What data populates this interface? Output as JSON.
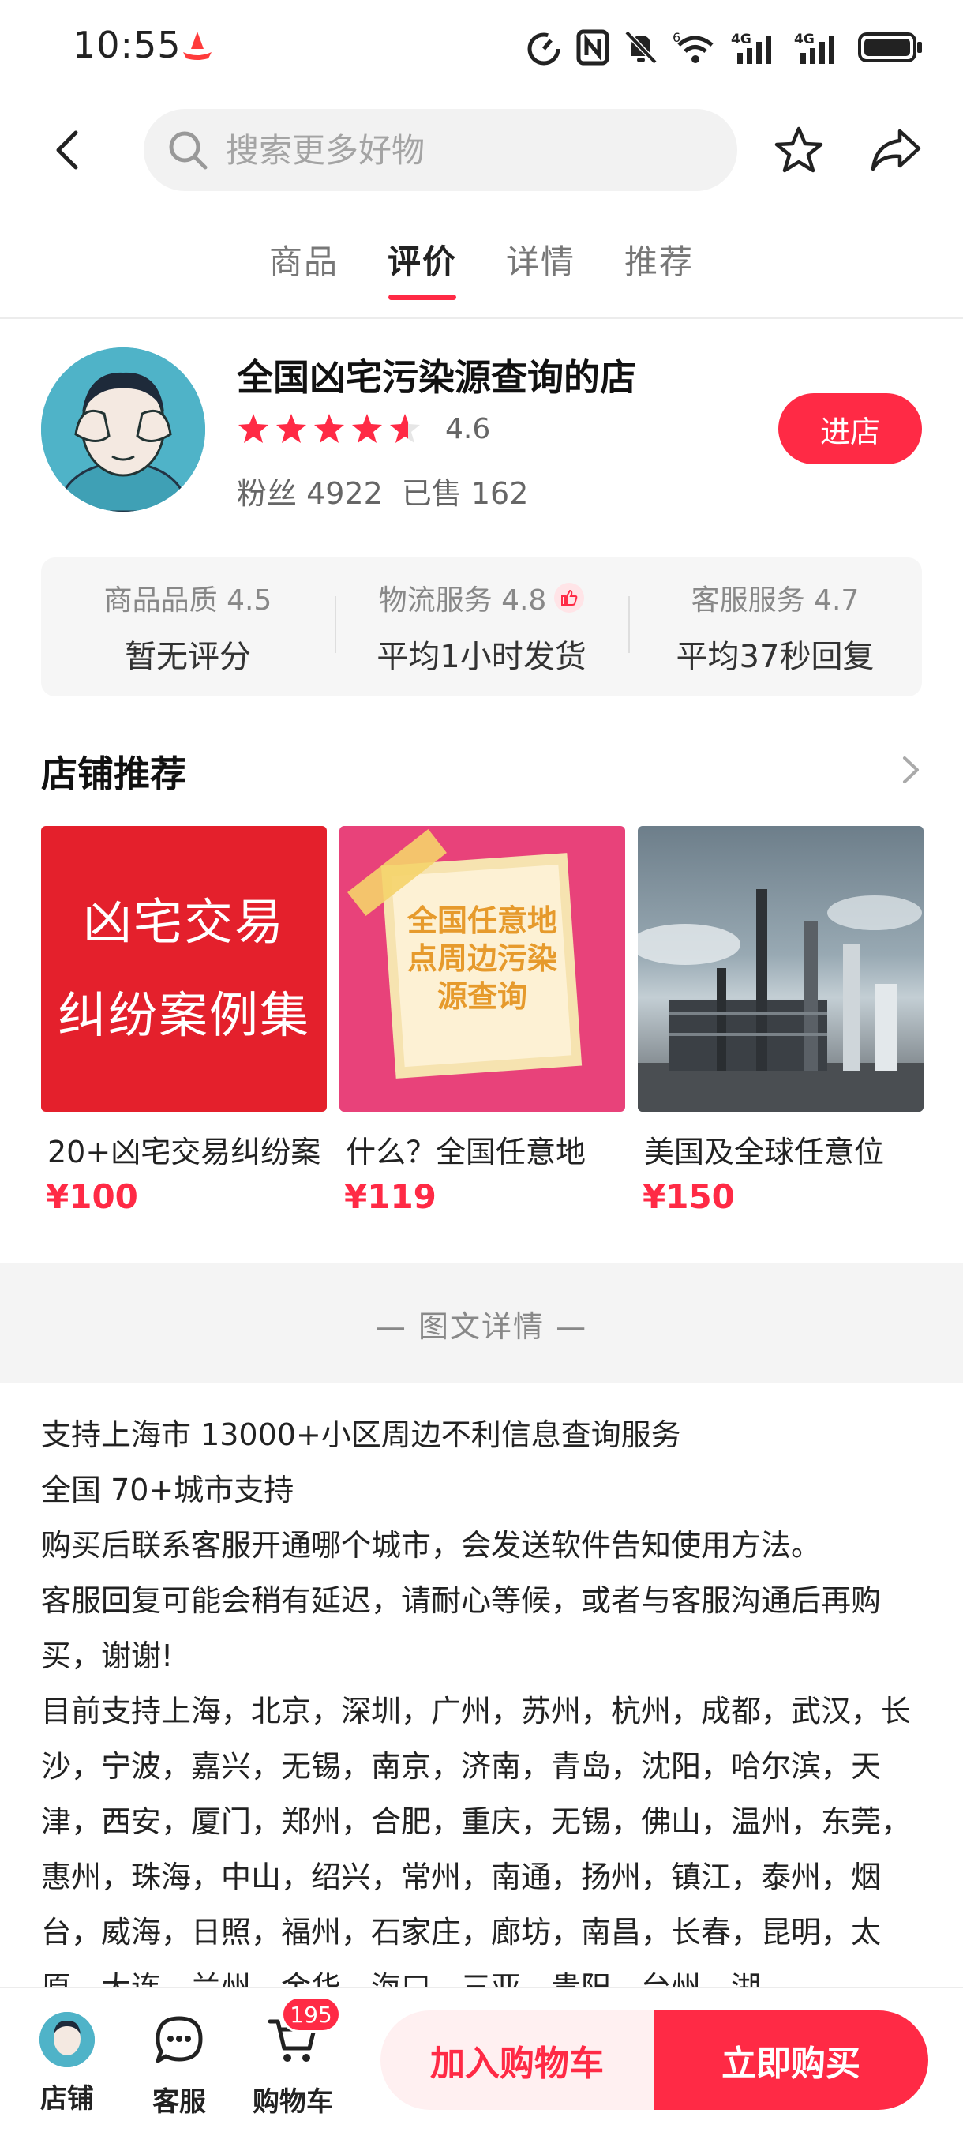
{
  "status_bar": {
    "time": "10:55",
    "signal_labels": [
      "4G",
      "4G"
    ],
    "wifi_label": "6"
  },
  "header": {
    "search_placeholder": "搜索更多好物",
    "icons": [
      "back-arrow-icon",
      "search-icon",
      "star-icon",
      "share-icon"
    ]
  },
  "tabs": [
    {
      "label": "商品",
      "active": false
    },
    {
      "label": "评价",
      "active": true
    },
    {
      "label": "详情",
      "active": false
    },
    {
      "label": "推荐",
      "active": false
    }
  ],
  "shop": {
    "name": "全国凶宅污染源查询的店",
    "rating": "4.6",
    "stars": 4.6,
    "fans_label": "粉丝 4922",
    "sold_label": "已售 162",
    "enter_label": "进店"
  },
  "scores": [
    {
      "label": "商品品质 4.5",
      "desc": "暂无评分"
    },
    {
      "label": "物流服务 4.8",
      "desc": "平均1小时发货"
    },
    {
      "label": "客服服务 4.7",
      "desc": "平均37秒回复"
    }
  ],
  "recommend": {
    "title": "店铺推荐",
    "items": [
      {
        "image_text": [
          "凶宅交易",
          "纠纷案例集"
        ],
        "name": "20+凶宅交易纠纷案",
        "price": "¥100"
      },
      {
        "image_text": [
          "全国任意地",
          "点周边污染",
          "源查询"
        ],
        "name": "什么？全国任意地",
        "price": "¥119"
      },
      {
        "image_text": [],
        "name": "美国及全球任意位",
        "price": "¥150"
      }
    ]
  },
  "detail": {
    "section_title": "— 图文详情 —",
    "paragraphs": [
      "支持上海市 13000+小区周边不利信息查询服务",
      "全国 70+城市支持",
      "购买后联系客服开通哪个城市，会发送软件告知使用方法。",
      "客服回复可能会稍有延迟，请耐心等候，或者与客服沟通后再购买，谢谢!",
      "目前支持上海，北京，深圳，广州，苏州，杭州，成都，武汉，长沙，宁波，嘉兴，无锡，南京，济南，青岛，沈阳，哈尔滨，天津，西安，厦门，郑州，合肥，重庆，无锡，佛山，温州，东莞，惠州，珠海，中山，绍兴，常州，南通，扬州，镇江，泰州，烟台，威海，日照，福州，石家庄，廊坊，南昌，长春，昆明，太原，大连，兰州，金华，海口，三亚，贵阳，台州，湖"
    ]
  },
  "bottom_bar": {
    "shop_label": "店铺",
    "service_label": "客服",
    "cart_label": "购物车",
    "cart_count": "195",
    "add_cart_label": "加入购物车",
    "buy_now_label": "立即购买"
  },
  "colors": {
    "accent": "#ff2a45",
    "panel_bg": "#f6f6f6",
    "band_bg": "#f4f4f4"
  }
}
